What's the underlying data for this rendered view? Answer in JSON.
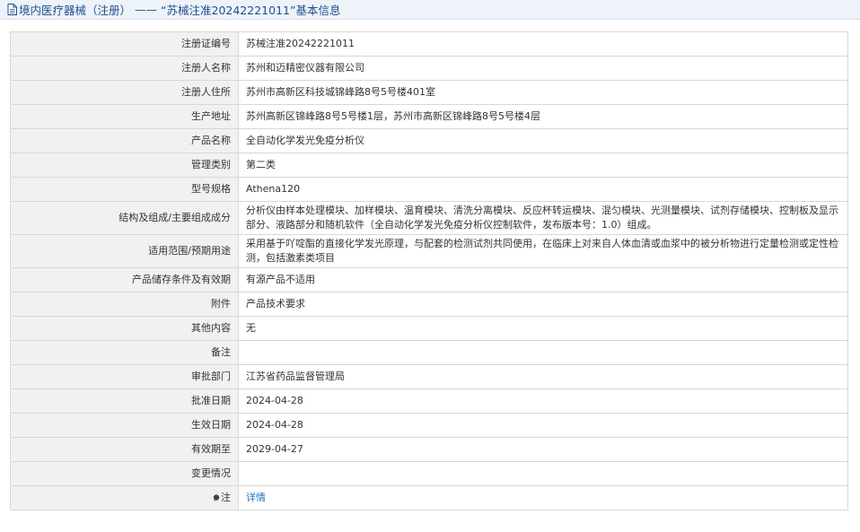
{
  "header": {
    "category": "境内医疗器械（注册）",
    "separator": "——",
    "record_title": "“苏械注准20242221011”基本信息"
  },
  "rows": [
    {
      "label": "注册证编号",
      "value": "苏械注准20242221011"
    },
    {
      "label": "注册人名称",
      "value": "苏州和迈精密仪器有限公司"
    },
    {
      "label": "注册人住所",
      "value": "苏州市高新区科技城锦峰路8号5号楼401室"
    },
    {
      "label": "生产地址",
      "value": "苏州高新区锦峰路8号5号楼1层，苏州市高新区锦峰路8号5号楼4层"
    },
    {
      "label": "产品名称",
      "value": "全自动化学发光免疫分析仪"
    },
    {
      "label": "管理类别",
      "value": "第二类"
    },
    {
      "label": "型号规格",
      "value": "Athena120"
    },
    {
      "label": "结构及组成/主要组成成分",
      "value": "分析仪由样本处理模块、加样模块、温育模块、清洗分离模块、反应杯转运模块、混匀模块、光测量模块、试剂存储模块、控制板及显示部分、液路部分和随机软件（全自动化学发光免疫分析仪控制软件，发布版本号：1.0）组成。"
    },
    {
      "label": "适用范围/预期用途",
      "value": "采用基于吖啶酯的直接化学发光原理，与配套的检测试剂共同使用，在临床上对来自人体血清或血浆中的被分析物进行定量检测或定性检测，包括激素类项目"
    },
    {
      "label": "产品储存条件及有效期",
      "value": "有源产品不适用"
    },
    {
      "label": "附件",
      "value": "产品技术要求"
    },
    {
      "label": "其他内容",
      "value": "无"
    },
    {
      "label": "备注",
      "value": ""
    },
    {
      "label": "审批部门",
      "value": "江苏省药品监督管理局"
    },
    {
      "label": "批准日期",
      "value": "2024-04-28"
    },
    {
      "label": "生效日期",
      "value": "2024-04-28"
    },
    {
      "label": "有效期至",
      "value": "2029-04-27"
    },
    {
      "label": "变更情况",
      "value": ""
    }
  ],
  "note_row": {
    "label": "注",
    "link_text": "详情",
    "icon": "pin-icon"
  },
  "colors": {
    "link": "#1f6fbf",
    "title": "#1f4e8c",
    "label_bg": "#f1f1f1",
    "border": "#d7d7d7"
  }
}
